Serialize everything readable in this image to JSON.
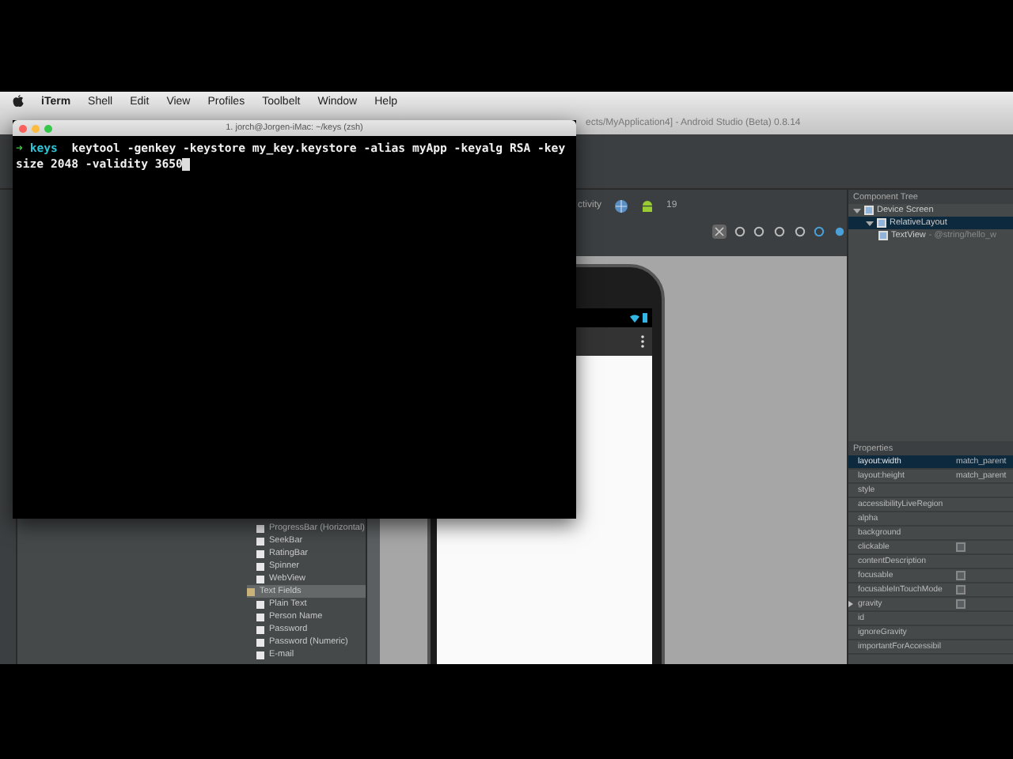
{
  "menu_bar": {
    "items": [
      {
        "label": "iTerm",
        "kind": "app"
      },
      {
        "label": "Shell",
        "kind": "menu"
      },
      {
        "label": "Edit",
        "kind": "menu"
      },
      {
        "label": "View",
        "kind": "menu"
      },
      {
        "label": "Profiles",
        "kind": "menu"
      },
      {
        "label": "Toolbelt",
        "kind": "menu"
      },
      {
        "label": "Window",
        "kind": "menu"
      },
      {
        "label": "Help",
        "kind": "menu"
      }
    ]
  },
  "ide": {
    "title": "ects/MyApplication4] - Android Studio (Beta) 0.8.14",
    "toolbar": {
      "activity": "ctivity",
      "api": "19"
    },
    "palette": [
      {
        "label": "ProgressBar (Horizontal)",
        "kind": "item",
        "selected": false
      },
      {
        "label": "SeekBar",
        "kind": "item",
        "selected": false
      },
      {
        "label": "RatingBar",
        "kind": "item",
        "selected": false
      },
      {
        "label": "Spinner",
        "kind": "item",
        "selected": false
      },
      {
        "label": "WebView",
        "kind": "item",
        "selected": false
      },
      {
        "label": "Text Fields",
        "kind": "group",
        "selected": true
      },
      {
        "label": "Plain Text",
        "kind": "item",
        "selected": false
      },
      {
        "label": "Person Name",
        "kind": "item",
        "selected": false
      },
      {
        "label": "Password",
        "kind": "item",
        "selected": false
      },
      {
        "label": "Password (Numeric)",
        "kind": "item",
        "selected": false
      },
      {
        "label": "E-mail",
        "kind": "item",
        "selected": false
      }
    ],
    "component_tree": {
      "title": "Component Tree",
      "nodes": [
        {
          "label": "Device Screen",
          "selected": false,
          "expanded": true,
          "children": [
            {
              "label": "RelativeLayout",
              "selected": true,
              "expanded": true,
              "children": [
                {
                  "label": "TextView",
                  "detail": "- @string/hello_w",
                  "selected": false
                }
              ]
            }
          ]
        }
      ]
    },
    "properties": {
      "title": "Properties",
      "rows": [
        {
          "name": "layout:width",
          "value": "match_parent",
          "kind": "text",
          "selected": true
        },
        {
          "name": "layout:height",
          "value": "match_parent",
          "kind": "text",
          "selected": false
        },
        {
          "name": "style",
          "kind": "text",
          "selected": false
        },
        {
          "name": "accessibilityLiveRegion",
          "kind": "text",
          "selected": false
        },
        {
          "name": "alpha",
          "kind": "text",
          "selected": false
        },
        {
          "name": "background",
          "kind": "text",
          "selected": false
        },
        {
          "name": "clickable",
          "kind": "checkbox",
          "checked": false,
          "selected": false
        },
        {
          "name": "contentDescription",
          "kind": "text",
          "selected": false
        },
        {
          "name": "focusable",
          "kind": "checkbox",
          "checked": false,
          "selected": false
        },
        {
          "name": "focusableInTouchMode",
          "kind": "checkbox",
          "checked": false,
          "selected": false
        },
        {
          "name": "gravity",
          "kind": "checkbox",
          "checked": false,
          "expanded": false,
          "selected": false
        },
        {
          "name": "id",
          "kind": "text",
          "selected": false
        },
        {
          "name": "ignoreGravity",
          "kind": "text",
          "selected": false
        },
        {
          "name": "importantForAccessibil",
          "kind": "text",
          "selected": false
        }
      ]
    }
  },
  "terminal": {
    "title": "1. jorch@Jorgen-iMac: ~/keys (zsh)",
    "prompt_symbol": "➜",
    "prompt_dir": "keys",
    "lines": [
      "keytool -genkey -keystore my_key.keystore -alias myApp -keyalg RSA -key",
      "size 2048 -validity 3650"
    ],
    "cursor": true
  }
}
